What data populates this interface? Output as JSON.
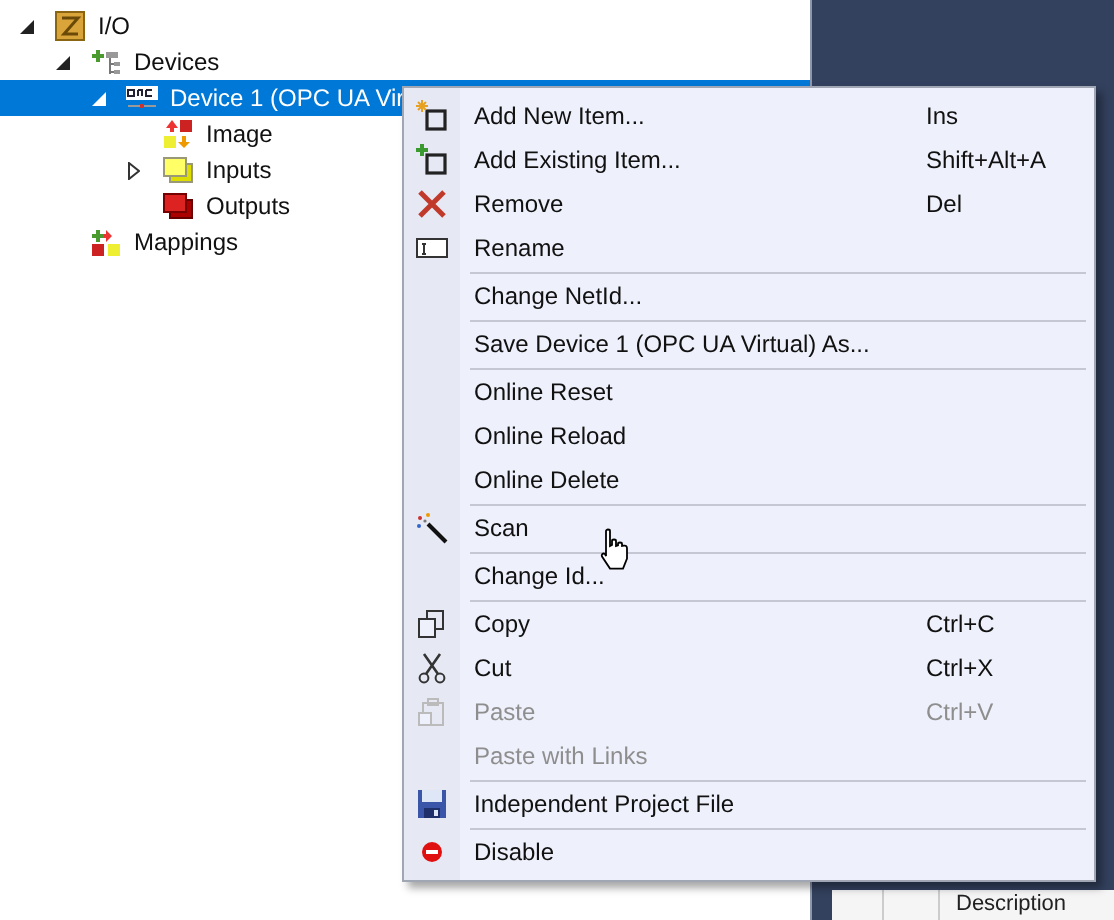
{
  "tree": [
    {
      "label": "I/O",
      "kind": "project",
      "expanded": true,
      "selected": false,
      "children": [
        {
          "label": "Devices",
          "kind": "devices",
          "expanded": true,
          "selected": false,
          "children": [
            {
              "label": "Device 1 (OPC UA Vir",
              "kind": "device",
              "expanded": true,
              "selected": true,
              "children": [
                {
                  "label": "Image",
                  "kind": "image",
                  "selected": false
                },
                {
                  "label": "Inputs",
                  "kind": "inputs",
                  "expanded": false,
                  "selected": false
                },
                {
                  "label": "Outputs",
                  "kind": "outputs",
                  "selected": false
                }
              ]
            }
          ]
        },
        {
          "label": "Mappings",
          "kind": "mappings",
          "selected": false
        }
      ]
    }
  ],
  "context_menu": {
    "groups": [
      [
        {
          "label": "Add New Item...",
          "shortcut": "Ins",
          "kind": "new",
          "disabled": false
        },
        {
          "label": "Add Existing Item...",
          "shortcut": "Shift+Alt+A",
          "kind": "existing",
          "disabled": false
        },
        {
          "label": "Remove",
          "shortcut": "Del",
          "kind": "remove",
          "disabled": false
        },
        {
          "label": "Rename",
          "kind": "rename",
          "disabled": false
        }
      ],
      [
        {
          "label": "Change NetId...",
          "kind": "plain",
          "disabled": false
        }
      ],
      [
        {
          "label": "Save Device 1 (OPC UA Virtual) As...",
          "kind": "plain",
          "disabled": false
        }
      ],
      [
        {
          "label": "Online Reset",
          "kind": "plain",
          "disabled": false
        },
        {
          "label": "Online Reload",
          "kind": "plain",
          "disabled": false
        },
        {
          "label": "Online Delete",
          "kind": "plain",
          "disabled": false
        }
      ],
      [
        {
          "label": "Scan",
          "kind": "scan",
          "disabled": false
        }
      ],
      [
        {
          "label": "Change Id...",
          "kind": "plain",
          "disabled": false
        }
      ],
      [
        {
          "label": "Copy",
          "shortcut": "Ctrl+C",
          "kind": "copy",
          "disabled": false
        },
        {
          "label": "Cut",
          "shortcut": "Ctrl+X",
          "kind": "cut",
          "disabled": false
        },
        {
          "label": "Paste",
          "shortcut": "Ctrl+V",
          "kind": "paste",
          "disabled": true
        },
        {
          "label": "Paste with Links",
          "kind": "plain",
          "disabled": true
        }
      ],
      [
        {
          "label": "Independent Project File",
          "kind": "save",
          "disabled": false
        }
      ],
      [
        {
          "label": "Disable",
          "kind": "disable",
          "disabled": false
        }
      ]
    ]
  },
  "details_panel": {
    "columns": [
      "Description"
    ]
  }
}
